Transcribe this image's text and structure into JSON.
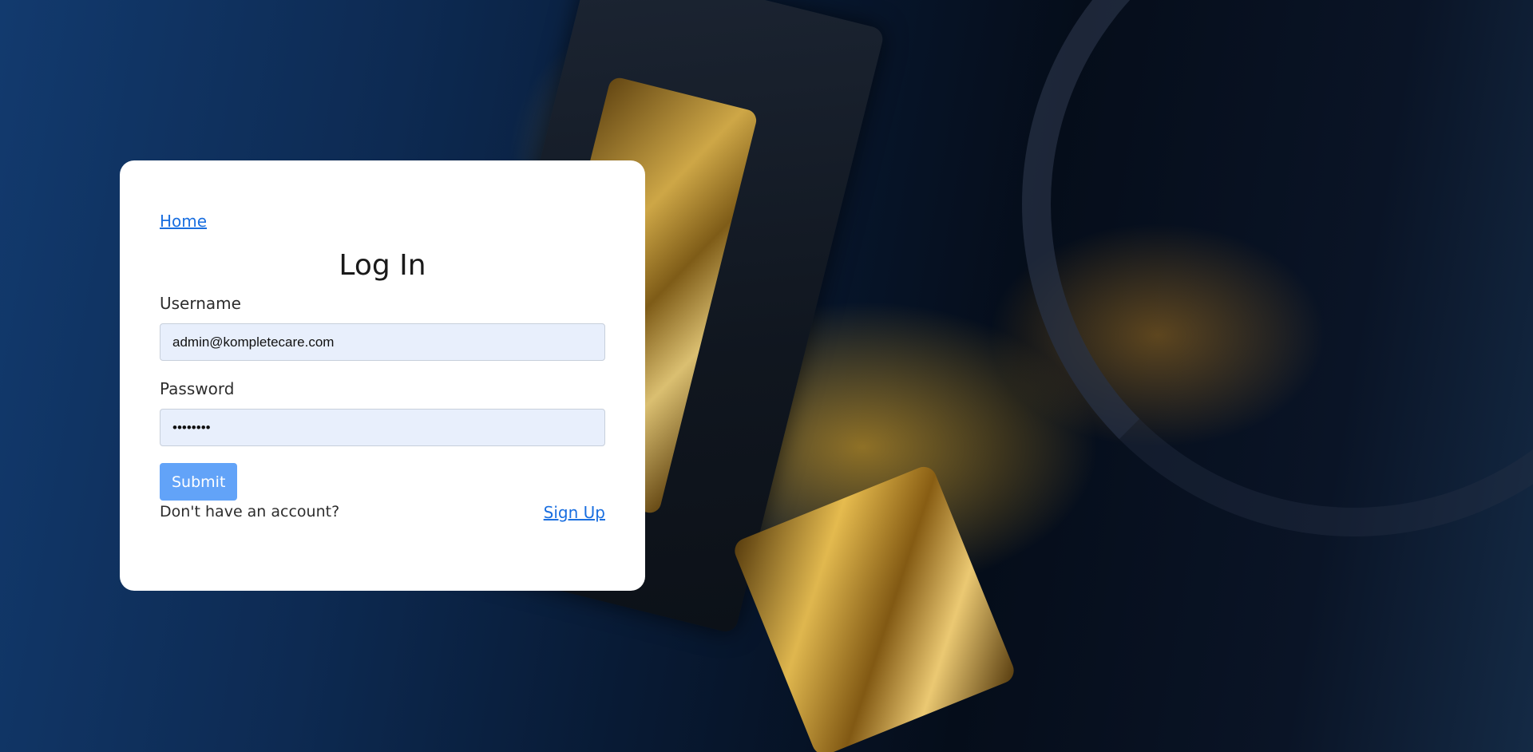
{
  "page": {
    "home_link": "Home",
    "title": "Log In"
  },
  "form": {
    "username": {
      "label": "Username",
      "value": "admin@kompletecare.com"
    },
    "password": {
      "label": "Password",
      "value": "••••••••"
    },
    "submit_label": "Submit"
  },
  "footer": {
    "prompt": "Don't have an account?",
    "signup_link": "Sign Up"
  },
  "colors": {
    "card_background": "#ffffff",
    "link": "#1a6fe0",
    "submit_button": "#62a3f8",
    "input_background": "#e8effc"
  }
}
